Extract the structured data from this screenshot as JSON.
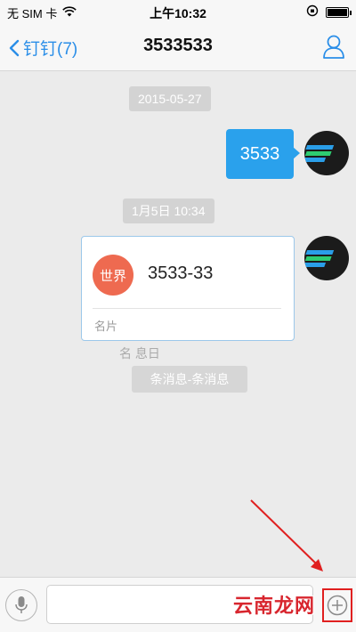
{
  "status_bar": {
    "carrier": "无 SIM 卡",
    "time": "上午10:32",
    "wifi_icon": "wifi-icon",
    "battery_icon": "battery-icon"
  },
  "nav": {
    "back_label": "钉钉(7)",
    "title": "3533533"
  },
  "chat": {
    "date_separator": "2015-05-27",
    "sent_message": "3533",
    "time_separator": "1月5日 10:34",
    "contact_card": {
      "avatar_text": "世界",
      "name": "3533-33",
      "type_label": "名片"
    },
    "system_notice_top": "名  息日",
    "system_notice": "条消息-条消息"
  },
  "input_bar": {
    "voice_icon": "microphone-icon",
    "plus_icon": "plus-icon"
  },
  "watermark": "云南龙网",
  "colors": {
    "accent": "#2a8ee8",
    "bubble": "#2aa1ec",
    "card_avatar": "#ee6a50",
    "annotation": "#e02020"
  }
}
